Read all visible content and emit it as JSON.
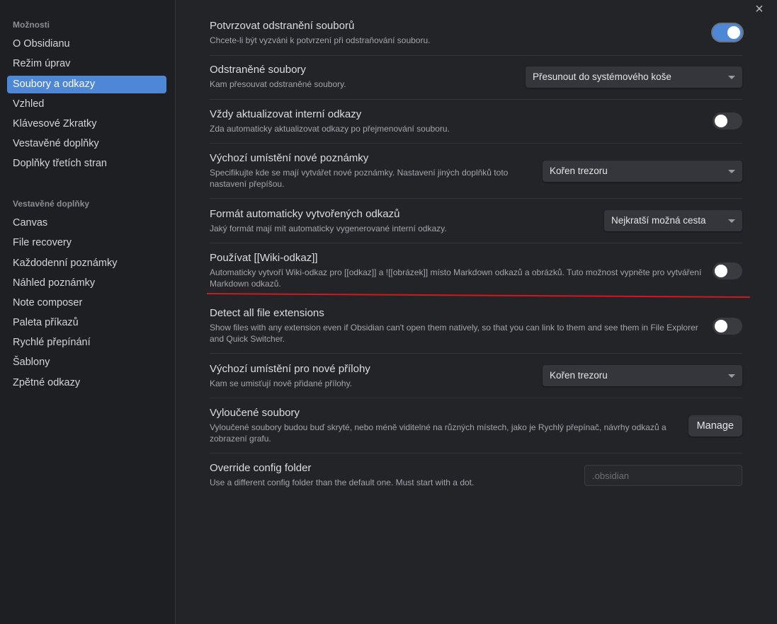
{
  "sidebar": {
    "options_header": "Možnosti",
    "options_items": [
      {
        "label": "O Obsidianu"
      },
      {
        "label": "Režim úprav"
      },
      {
        "label": "Soubory a odkazy"
      },
      {
        "label": "Vzhled"
      },
      {
        "label": "Klávesové Zkratky"
      },
      {
        "label": "Vestavěné doplňky"
      },
      {
        "label": "Doplňky třetích stran"
      }
    ],
    "plugins_header": "Vestavěné doplňky",
    "plugin_items": [
      {
        "label": "Canvas"
      },
      {
        "label": "File recovery"
      },
      {
        "label": "Každodenní poznámky"
      },
      {
        "label": "Náhled poznámky"
      },
      {
        "label": "Note composer"
      },
      {
        "label": "Paleta příkazů"
      },
      {
        "label": "Rychlé přepínání"
      },
      {
        "label": "Šablony"
      },
      {
        "label": "Zpětné odkazy"
      }
    ],
    "active_item": "Soubory a odkazy"
  },
  "close_icon": "×",
  "settings": [
    {
      "title": "Potvrzovat odstranění souborů",
      "desc": "Chcete-li být vyzváni k potvrzení při odstraňování souboru.",
      "control": "toggle",
      "on": true
    },
    {
      "title": "Odstraněné soubory",
      "desc": "Kam přesouvat odstraněné soubory.",
      "control": "dropdown",
      "value": "Přesunout do systémového koše"
    },
    {
      "title": "Vždy aktualizovat interní odkazy",
      "desc": "Zda automaticky aktualizovat odkazy po přejmenování souboru.",
      "control": "toggle",
      "on": false
    },
    {
      "title": "Výchozí umístění nové poznámky",
      "desc": "Specifikujte kde se mají vytvářet nové poznámky. Nastavení jiných doplňků toto nastavení přepíšou.",
      "control": "dropdown",
      "value": "Kořen trezoru"
    },
    {
      "title": "Formát automaticky vytvořených odkazů",
      "desc": "Jaký formát mají mít automaticky vygenerované interní odkazy.",
      "control": "dropdown",
      "value": "Nejkratší možná cesta"
    },
    {
      "title": "Používat [[Wiki-odkaz]]",
      "desc": "Automaticky vytvoří Wiki-odkaz pro [[odkaz]] a ![[obrázek]] místo Markdown odkazů a obrázků. Tuto možnost vypněte pro vytváření Markdown odkazů.",
      "control": "toggle",
      "on": false
    },
    {
      "title": "Detect all file extensions",
      "desc": "Show files with any extension even if Obsidian can't open them natively, so that you can link to them and see them in File Explorer and Quick Switcher.",
      "control": "toggle",
      "on": false
    },
    {
      "title": "Výchozí umístění pro nové přílohy",
      "desc": "Kam se umisťují nově přidané přílohy.",
      "control": "dropdown",
      "value": "Kořen trezoru"
    },
    {
      "title": "Vyloučené soubory",
      "desc": "Vyloučené soubory budou buď skryté, nebo méně viditelné na různých místech, jako je Rychlý přepínač, návrhy odkazů a zobrazení grafu.",
      "control": "button",
      "value": "Manage"
    },
    {
      "title": "Override config folder",
      "desc": "Use a different config folder than the default one. Must start with a dot.",
      "control": "input",
      "placeholder": ".obsidian"
    }
  ],
  "colors": {
    "accent": "#4d87d6",
    "annotation_line": "#d0191f"
  }
}
